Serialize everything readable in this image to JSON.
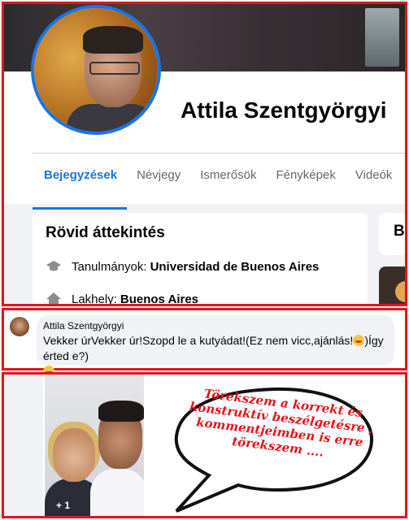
{
  "profile": {
    "name": "Attila Szentgyörgyi",
    "tabs": [
      "Bejegyzések",
      "Névjegy",
      "Ismerősök",
      "Fényképek",
      "Videók"
    ]
  },
  "intro": {
    "title": "Rövid áttekintés",
    "studies_label": "Tanulmányok:",
    "studies_value": "Universidad de Buenos Aires",
    "lives_label": "Lakhely:",
    "lives_value": "Buenos Aires"
  },
  "right_card": {
    "title_fragment": "Be"
  },
  "comment": {
    "author": "Attila Szentgyörgyi",
    "tag": "Vekker úr",
    "text_1": "Vekker úr!Szopd le a kutyádat!(Ez nem vicc,ajánlás!",
    "text_2": ")Így érted e?)"
  },
  "photo": {
    "badge": "+ 1"
  },
  "speech_bubble": {
    "lines": [
      "Törekszem a korrekt és",
      "konstruktív beszélgetésre ,",
      "kommentjeimben is erre",
      "törekszem ...."
    ]
  },
  "colors": {
    "accent": "#1b74e4",
    "frame": "#e4141b",
    "speech_text": "#e4141b"
  }
}
